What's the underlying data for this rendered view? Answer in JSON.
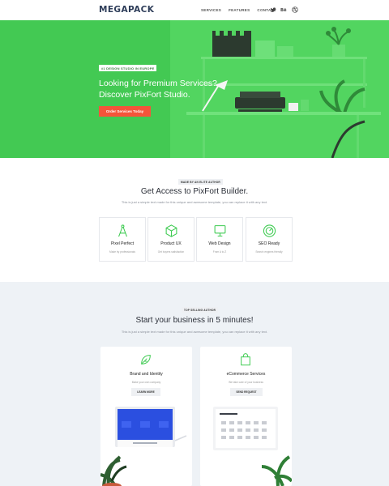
{
  "header": {
    "logo": "MEGAPACK",
    "nav": [
      "SERVICES",
      "FEATURES",
      "CONTACT"
    ],
    "social_icons": [
      "twitter-icon",
      "behance-icon",
      "dribbble-icon"
    ]
  },
  "hero": {
    "badge": "#1 DESIGN STUDIO IN EUROPE",
    "title_line1": "Looking for Premium Services?",
    "title_line2": "Discover PixFort Studio.",
    "button": "Order Services Today",
    "background_color": "#43c953"
  },
  "access": {
    "badge": "MADE BY AN ELITE AUTHOR",
    "title": "Get Access to PixFort Builder.",
    "subtitle": "This is just a simple text made for this unique and awesome template, you can replace it with any text.",
    "features": [
      {
        "title": "Pixel Perfect",
        "desc": "Made by professionals",
        "icon": "compass-icon"
      },
      {
        "title": "Product UX",
        "desc": "Get buyers satisfaction",
        "icon": "box-icon"
      },
      {
        "title": "Web Design",
        "desc": "From A to Z",
        "icon": "monitor-icon"
      },
      {
        "title": "SEO Ready",
        "desc": "Search engines friendly",
        "icon": "gauge-icon"
      }
    ]
  },
  "business": {
    "badge": "TOP SELLING AUTHOR",
    "title": "Start your business in 5 minutes!",
    "subtitle": "This is just a simple text made for this unique and awesome template, you can replace it with any text.",
    "cards": [
      {
        "title": "Brand and Identity",
        "desc": "Make your own company",
        "button": "LEARN MORE",
        "icon": "leaf-icon"
      },
      {
        "title": "eCommerce Services",
        "desc": "We take care of your business",
        "button": "SEND REQUEST",
        "icon": "shopping-bag-icon"
      }
    ]
  },
  "colors": {
    "accent_green": "#3fcb52",
    "cta_red": "#f5543a",
    "navy": "#2e3d59",
    "blue_screen": "#2b4fe0"
  }
}
